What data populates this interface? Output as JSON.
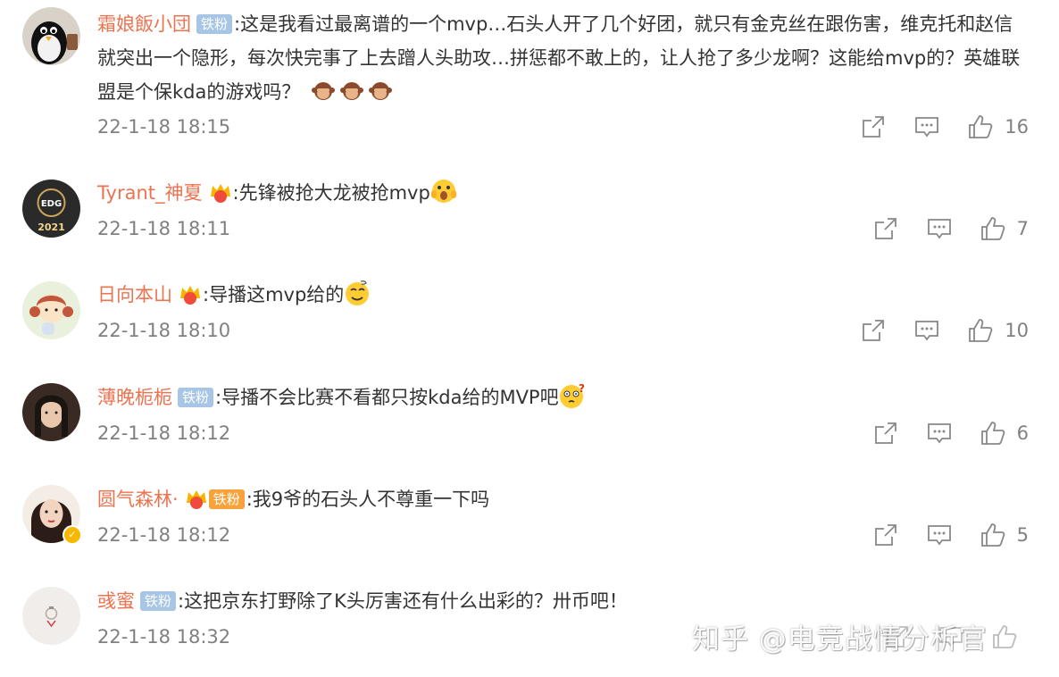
{
  "comments": [
    {
      "username": "霜娘飯小団",
      "badge": "铁粉",
      "text": ":这是我看过最离谱的一个mvp…石头人开了几个好团，就只有金克丝在跟伤害，维克托和赵信就突出一个隐形，每次快完事了上去蹭人头助攻…拼惩都不敢上的，让人抢了多少龙啊？这能给mvp的？英雄联盟是个保kda的游戏吗？",
      "emoji": "monkey-emoji-x3",
      "time": "22-1-18 18:15",
      "likes": "16"
    },
    {
      "username": "Tyrant_神夏",
      "badge_icon": "crown-badge-icon",
      "text": ":先锋被抢大龙被抢mvp",
      "emoji": "scared-face-emoji",
      "avatar_text": "2021",
      "time": "22-1-18 18:11",
      "likes": "7"
    },
    {
      "username": "日向本山",
      "badge_icon": "crown-badge-icon",
      "text": ":导播这mvp给的",
      "emoji": "dizzy-face-emoji",
      "time": "22-1-18 18:10",
      "likes": "10"
    },
    {
      "username": "薄晚栀栀",
      "badge": "铁粉",
      "text": ":导播不会比赛不看都只按kda给的MVP吧",
      "emoji": "confused-face-emoji",
      "time": "22-1-18 18:12",
      "likes": "6"
    },
    {
      "username": "圆气森林·",
      "badge_icon": "crown-level-icon",
      "badge": "铁粉",
      "text": ":我9爷的石头人不尊重一下吗",
      "time": "22-1-18 18:12",
      "likes": "5"
    },
    {
      "username": "彧蜜",
      "badge": "铁粉",
      "text": ":这把京东打野除了K头厉害还有什么出彩的？卅币吧！",
      "time": "22-1-18 18:32",
      "likes": ""
    }
  ],
  "watermark": "知乎 @电竞战情分析官",
  "colors": {
    "username": "#eb7350",
    "fan_badge": "#a7c6e6",
    "text": "#333333",
    "meta": "#808080"
  }
}
